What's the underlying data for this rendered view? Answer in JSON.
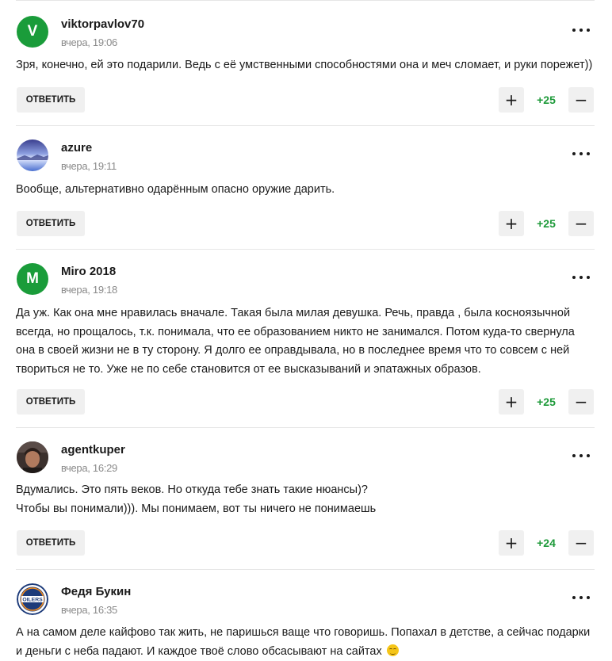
{
  "comments": [
    {
      "username": "viktorpavlov70",
      "avatar_letter": "V",
      "time": "вчера, 19:06",
      "text": "Зря, конечно, ей это подарили. Ведь с её умственными способностями она и меч сломает, и руки порежет))",
      "reply_label": "ОТВЕТИТЬ",
      "score": "+25"
    },
    {
      "username": "azure",
      "avatar_letter": "",
      "time": "вчера, 19:11",
      "text": "Вообще, альтернативно одарённым опасно оружие дарить.",
      "reply_label": "ОТВЕТИТЬ",
      "score": "+25"
    },
    {
      "username": "Miro 2018",
      "avatar_letter": "M",
      "time": "вчера, 19:18",
      "text": "Да уж. Как она мне нравилась вначале. Такая была милая девушка. Речь, правда , была косноязычной всегда, но прощалось, т.к. понимала, что ее образованием никто не занимался. Потом куда-то свернула она в своей жизни не в ту сторону. Я долго ее оправдывала, но в последнее время что то совсем с ней твориться не то. Уже не по себе становится от ее высказываний и эпатажных образов.",
      "reply_label": "ОТВЕТИТЬ",
      "score": "+25"
    },
    {
      "username": "agentkuper",
      "avatar_letter": "",
      "time": "вчера, 16:29",
      "text": "Вдумались. Это пять веков. Но откуда тебе знать такие нюансы)?\nЧтобы вы понимали))). Мы понимаем, вот ты ничего не понимаешь",
      "reply_label": "ОТВЕТИТЬ",
      "score": "+24"
    },
    {
      "username": "Федя Букин",
      "avatar_letter": "",
      "avatar_logo_text": "OILERS",
      "time": "вчера, 16:35",
      "text": "А на самом деле кайфово так жить, не паришься ваще что говоришь. Попахал в детстве, а сейчас подарки и деньги с неба падают. И каждое твоё слово обсасывают на сайтах",
      "emoji": "smiling-face"
    }
  ],
  "colors": {
    "accent_green": "#1e9a3a",
    "avatar_green": "#1a9c3a",
    "button_bg": "#f0f0f0"
  },
  "icons": {
    "more": "more-dots-icon",
    "plus": "plus-icon",
    "minus": "minus-icon"
  }
}
